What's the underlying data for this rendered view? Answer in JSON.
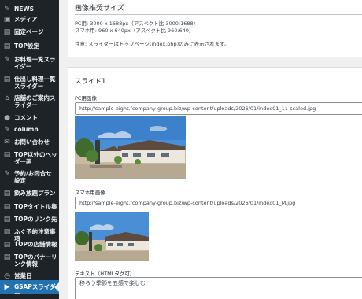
{
  "sidebar": {
    "items": [
      {
        "icon": "pin-icon",
        "glyph": "✎",
        "label": "NEWS"
      },
      {
        "icon": "media-icon",
        "glyph": "▣",
        "label": "メディア"
      },
      {
        "icon": "page-icon",
        "glyph": "▤",
        "label": "固定ページ"
      },
      {
        "icon": "page-icon",
        "glyph": "▤",
        "label": "TOP設定"
      },
      {
        "icon": "pin-icon",
        "glyph": "✎",
        "label": "お料理一覧スライダー"
      },
      {
        "icon": "page-icon",
        "glyph": "▤",
        "label": "仕出し料理一覧スライダー"
      },
      {
        "icon": "store-icon",
        "glyph": "⌂",
        "label": "店舗のご案内スライダー"
      },
      {
        "icon": "comment-icon",
        "glyph": "●",
        "label": "コメント"
      },
      {
        "icon": "pin-icon",
        "glyph": "✎",
        "label": "column"
      },
      {
        "icon": "mail-icon",
        "glyph": "✉",
        "label": "お問い合わせ"
      },
      {
        "icon": "page-icon",
        "glyph": "▤",
        "label": "TOP以外のヘッダー画"
      },
      {
        "icon": "pin-icon",
        "glyph": "✎",
        "label": "予約/お問合せ設定"
      },
      {
        "icon": "page-icon",
        "glyph": "▤",
        "label": "飲み放題プラン"
      },
      {
        "icon": "page-icon",
        "glyph": "▤",
        "label": "TOPタイトル集"
      },
      {
        "icon": "page-icon",
        "glyph": "▤",
        "label": "TOPのリンク先"
      },
      {
        "icon": "page-icon",
        "glyph": "▤",
        "label": "ふぐ予約注意事項"
      },
      {
        "icon": "page-icon",
        "glyph": "▤",
        "label": "TOPの店舗情報"
      },
      {
        "icon": "page-icon",
        "glyph": "▤",
        "label": "TOPのバナーリンク情報"
      },
      {
        "icon": "clock-icon",
        "glyph": "◷",
        "label": "営業日"
      },
      {
        "icon": "slider-icon",
        "glyph": "▶",
        "label": "GSAPスライダー"
      }
    ]
  },
  "recommended": {
    "title": "画像推奨サイズ",
    "pc_line": "PC用: 3000 x 1688px（アスペクト比 3000:1688）",
    "sp_line": "スマホ用: 960 x 640px（アスペクト比 960:640）",
    "note": "注意: スライダーはトップページ(index.php)のみに表示されます。"
  },
  "slide": {
    "title": "スライド1",
    "pc_label": "PC用画像",
    "pc_url": "http://sample-eight.fcompany-group.biz/wp-content/uploads/2026/01/index01_11-scaled.jpg",
    "sp_label": "スマホ用画像",
    "sp_url": "http://sample-eight.fcompany-group.biz/wp-content/uploads/2026/01/index01_M.jpg",
    "text_label": "テキスト（HTMLタグ可）",
    "text_value": "移ろう季節を五感で楽しむ"
  }
}
